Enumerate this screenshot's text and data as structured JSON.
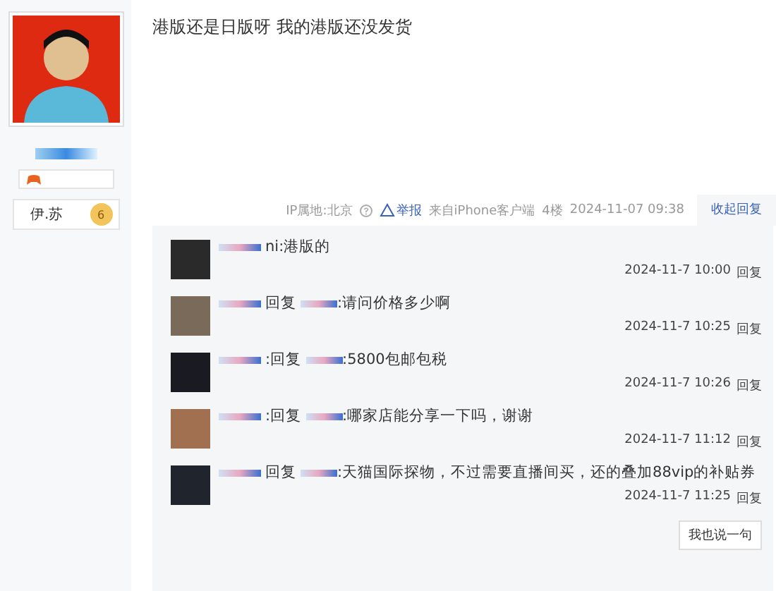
{
  "author": {
    "badge_name": "伊.苏",
    "rank": "6"
  },
  "post": {
    "text": "港版还是日版呀 我的港版还没发货"
  },
  "meta": {
    "ip": "IP属地:北京",
    "report": "举报",
    "source": "来自iPhone客户端",
    "floor": "4楼",
    "time": "2024-11-07 09:38",
    "collapse": "收起回复"
  },
  "replies": [
    {
      "prefix": "ni:",
      "content": "港版的",
      "time": "2024-11-7 10:00",
      "reply": "回复"
    },
    {
      "reply_word": "回复",
      "content": ":请问价格多少啊",
      "time": "2024-11-7 10:25",
      "reply": "回复"
    },
    {
      "prefix": ":",
      "reply_word": "回复",
      "content": ":5800包邮包税",
      "time": "2024-11-7 10:26",
      "reply": "回复"
    },
    {
      "prefix": ":",
      "reply_word": "回复",
      "content": ":哪家店能分享一下吗，谢谢",
      "time": "2024-11-7 11:12",
      "reply": "回复"
    },
    {
      "reply_word": "回复",
      "content": ":天猫国际探物，不过需要直播间买，还的叠加88vip的补贴券",
      "time": "2024-11-7 11:25",
      "reply": "回复"
    }
  ],
  "say_button": "我也说一句"
}
